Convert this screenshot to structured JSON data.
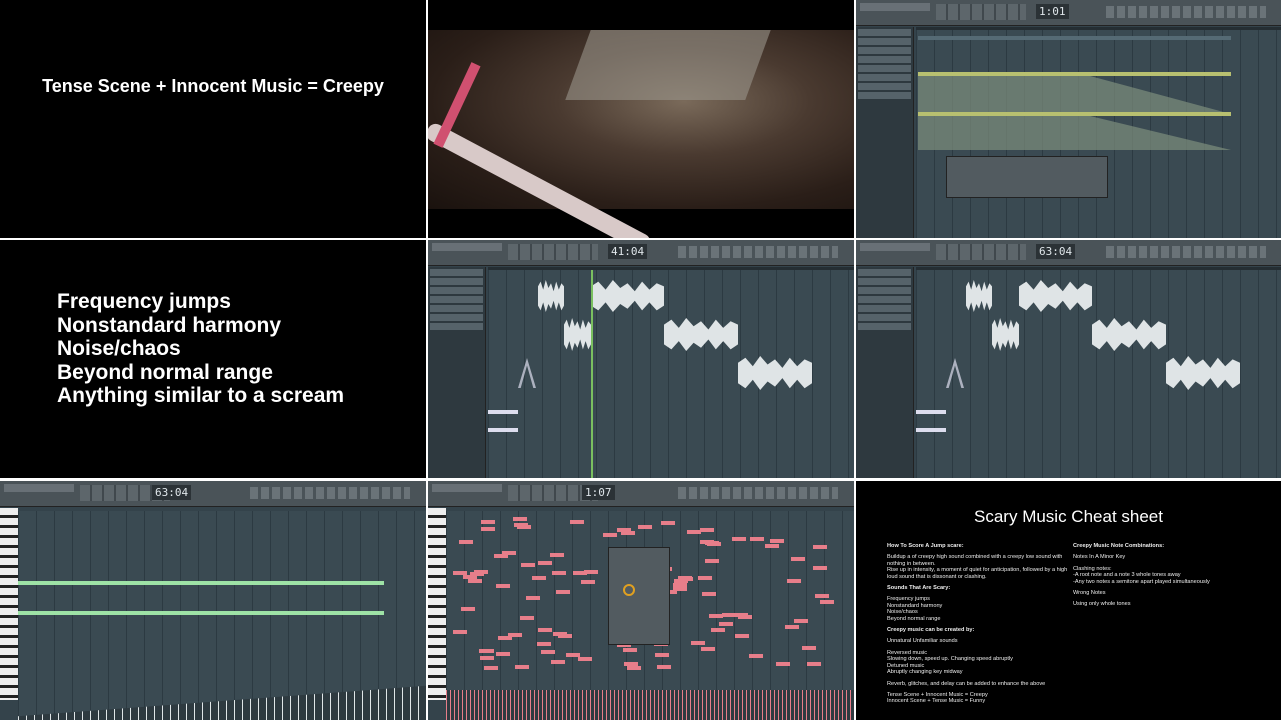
{
  "slides": {
    "equation": "Tense Scene + Innocent Music = Creepy",
    "list": [
      "Frequency jumps",
      "Nonstandard harmony",
      "Noise/chaos",
      "Beyond normal range",
      "Anything similar to a scream"
    ]
  },
  "daw": {
    "time_top_right": "1:01",
    "time_mid_center": "41:04",
    "time_mid_right": "63:04",
    "time_bottom_left": "63:04",
    "time_bottom_center": "1:07"
  },
  "cheat_sheet": {
    "title": "Scary Music Cheat sheet",
    "left": [
      {
        "h": "How To Score A Jump scare:"
      },
      {
        "p": "Buildup a of creepy high sound combined with a creepy low sound with nothing in between.\nRise up in intensity, a moment of quiet for anticipation, followed by a high loud sound that is dissonant or clashing."
      },
      {
        "h": "Sounds That Are Scary:"
      },
      {
        "p": "Frequency jumps\nNonstandard harmony\nNoise/chaos\nBeyond normal range"
      },
      {
        "h": "Creepy music can be created by:"
      },
      {
        "p": "Unnatural Unfamiliar sounds"
      },
      {
        "p": "Reversed music\nSlowing down, speed up. Changing speed abruptly\nDetuned music\nAbruptly changing key midway"
      },
      {
        "p": "Reverb, glitches, and delay can be added to enhance the above"
      },
      {
        "p": "Tense Scene + Innocent Music = Creepy\nInnocent Scene + Tense Music = Funny"
      }
    ],
    "right": [
      {
        "h": "Creepy Music Note Combinations:"
      },
      {
        "p": "Notes In A Minor Key"
      },
      {
        "p": "Clashing notes:\n-A root note and a note 3 whole tones away\n-Any two notes a semitone apart played simultaneously"
      },
      {
        "p": "Wrong Notes"
      },
      {
        "p": "Using only whole tones"
      }
    ]
  }
}
